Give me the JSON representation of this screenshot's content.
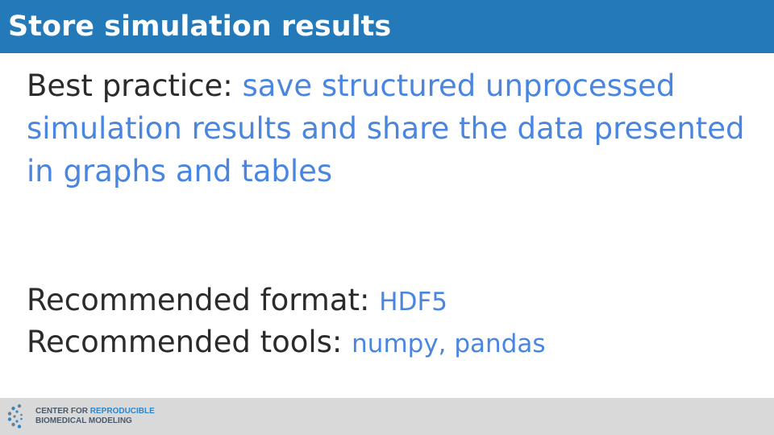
{
  "slide": {
    "title": "Store simulation results",
    "best_practice_label": "Best practice: ",
    "best_practice_text": "save structured unprocessed simulation results and share the data presented in graphs and tables",
    "format_label": "Recommended format: ",
    "format_value": "HDF5",
    "tools_label": "Recommended tools: ",
    "tools_value": "numpy, pandas"
  },
  "footer": {
    "logo_line1_a": "CENTER FOR ",
    "logo_line1_b": "REPRODUCIBLE",
    "logo_line2": "BIOMEDICAL MODELING"
  },
  "colors": {
    "title_bar": "#2479b9",
    "highlight": "#4a86e0",
    "footer_bg": "#d9d9d9"
  }
}
